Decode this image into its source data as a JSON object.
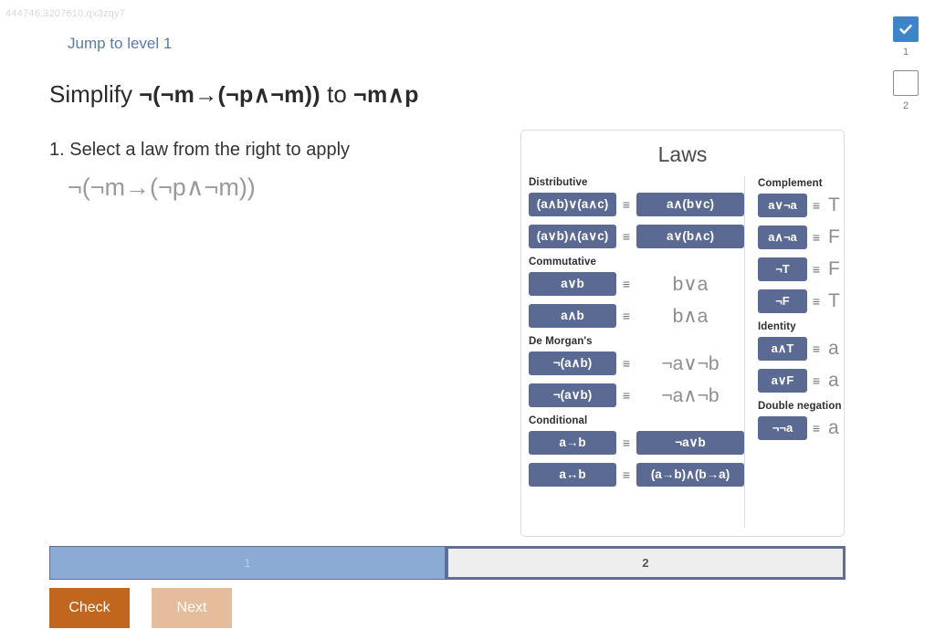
{
  "watermark": "444746.3207610.qx3zqy7",
  "jump_link": "Jump to level 1",
  "steps": [
    {
      "num": "1",
      "state": "done",
      "icon": "check-icon"
    },
    {
      "num": "2",
      "state": "todo",
      "icon": "empty-checkbox-icon"
    }
  ],
  "problem": {
    "prefix": "Simplify",
    "source": "¬(¬m→(¬p∧¬m))",
    "connector": "to",
    "target": "¬m∧p"
  },
  "instruction": "1. Select a law from the right to apply",
  "working_expression": "¬(¬m→(¬p∧¬m))",
  "laws": {
    "title": "Laws",
    "left_sections": [
      {
        "name": "Distributive",
        "rows": [
          {
            "lhs": "(a∧b)∨(a∧c)",
            "op": "≡",
            "rhs": "a∧(b∨c)",
            "rhs_style": "button"
          },
          {
            "lhs": "(a∨b)∧(a∨c)",
            "op": "≡",
            "rhs": "a∨(b∧c)",
            "rhs_style": "button"
          }
        ]
      },
      {
        "name": "Commutative",
        "rows": [
          {
            "lhs": "a∨b",
            "op": "≡",
            "rhs": "b∨a",
            "rhs_style": "plain"
          },
          {
            "lhs": "a∧b",
            "op": "≡",
            "rhs": "b∧a",
            "rhs_style": "plain"
          }
        ]
      },
      {
        "name": "De Morgan's",
        "rows": [
          {
            "lhs": "¬(a∧b)",
            "op": "≡",
            "rhs": "¬a∨¬b",
            "rhs_style": "plain"
          },
          {
            "lhs": "¬(a∨b)",
            "op": "≡",
            "rhs": "¬a∧¬b",
            "rhs_style": "plain"
          }
        ]
      },
      {
        "name": "Conditional",
        "rows": [
          {
            "lhs": "a→b",
            "op": "≡",
            "rhs": "¬a∨b",
            "rhs_style": "button"
          },
          {
            "lhs": "a↔b",
            "op": "≡",
            "rhs": "(a→b)∧(b→a)",
            "rhs_style": "button"
          }
        ]
      }
    ],
    "right_sections": [
      {
        "name": "Complement",
        "rows": [
          {
            "lhs": "a∨¬a",
            "op": "≡",
            "rhs": "T",
            "rhs_style": "plain"
          },
          {
            "lhs": "a∧¬a",
            "op": "≡",
            "rhs": "F",
            "rhs_style": "plain"
          },
          {
            "lhs": "¬T",
            "op": "≡",
            "rhs": "F",
            "rhs_style": "plain"
          },
          {
            "lhs": "¬F",
            "op": "≡",
            "rhs": "T",
            "rhs_style": "plain"
          }
        ]
      },
      {
        "name": "Identity",
        "rows": [
          {
            "lhs": "a∧T",
            "op": "≡",
            "rhs": "a",
            "rhs_style": "plain"
          },
          {
            "lhs": "a∨F",
            "op": "≡",
            "rhs": "a",
            "rhs_style": "plain"
          }
        ]
      },
      {
        "name": "Double negation",
        "rows": [
          {
            "lhs": "¬¬a",
            "op": "≡",
            "rhs": "a",
            "rhs_style": "plain"
          }
        ]
      }
    ]
  },
  "progress_tabs": [
    {
      "label": "1",
      "state": "completed"
    },
    {
      "label": "2",
      "state": "active"
    }
  ],
  "actions": {
    "check_label": "Check",
    "next_label": "Next"
  },
  "colors": {
    "law_button": "#5a6a93",
    "check_button": "#c0661f",
    "next_button": "#e5bc9c",
    "tab_completed": "#8cabd4",
    "tab_active_border": "#5d6f96",
    "checkbox_done": "#3d85c8",
    "link": "#5a7aa8"
  }
}
